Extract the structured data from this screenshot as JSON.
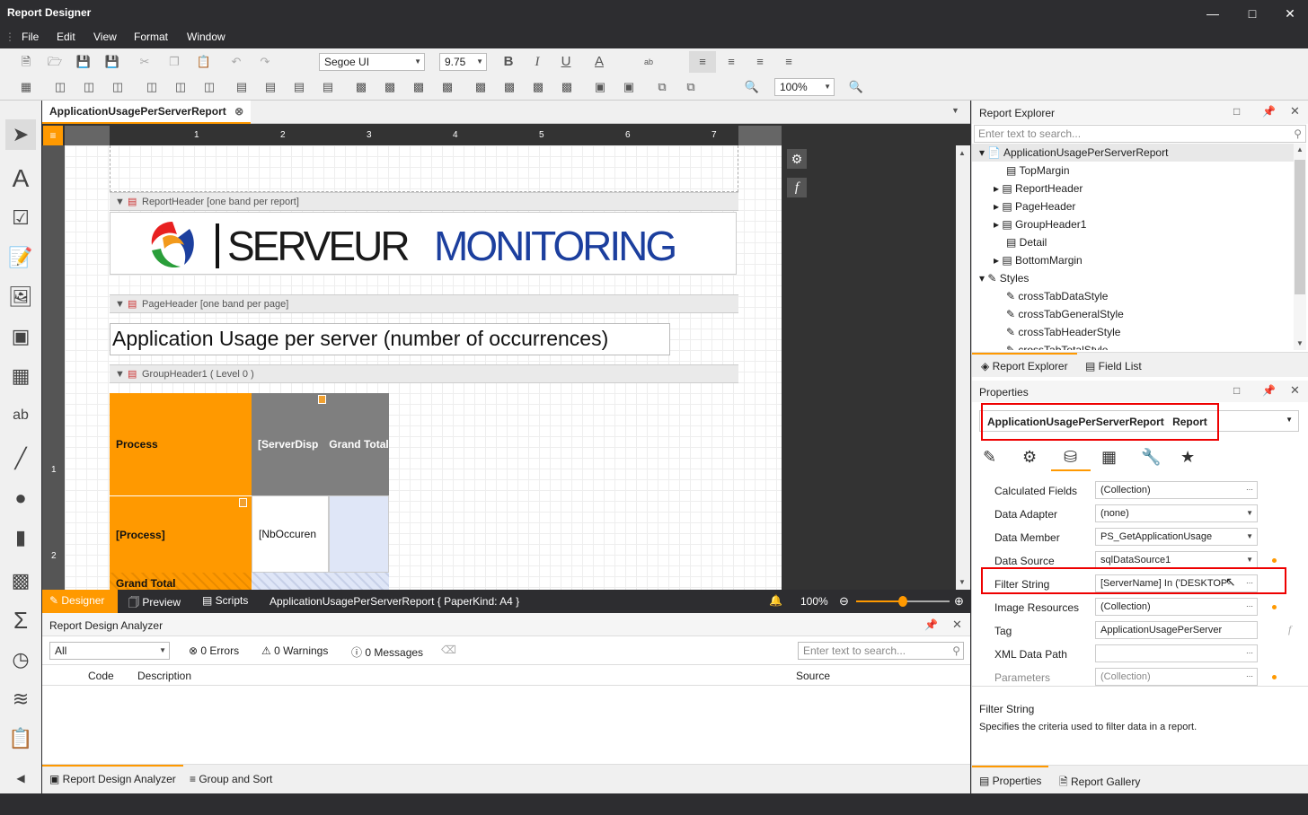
{
  "window": {
    "title": "Report Designer"
  },
  "menu": [
    "File",
    "Edit",
    "View",
    "Format",
    "Window"
  ],
  "toolbar": {
    "font_name": "Segoe UI",
    "font_size": "9.75",
    "zoom": "100%"
  },
  "document_tab": {
    "label": "ApplicationUsagePerServerReport"
  },
  "ruler": {
    "ticks": [
      "1",
      "2",
      "3",
      "4",
      "5",
      "6",
      "7"
    ],
    "vticks": [
      "1",
      "2"
    ]
  },
  "report": {
    "report_header_band": "ReportHeader [one band per report]",
    "logo_text_a": "SERVEUR",
    "logo_text_b": "MONITORING",
    "page_header_band": "PageHeader [one band per page]",
    "page_title": "Application Usage per server (number of occurrences)",
    "group_header_band": "GroupHeader1 ( Level 0 )",
    "crosstab": {
      "process_header": "Process",
      "server_header": "[ServerDisp",
      "grand_total_header": "Grand Total",
      "process_field": "[Process]",
      "occurrences_field": "[NbOccuren",
      "grand_total_row": "Grand Total"
    }
  },
  "status": {
    "designer": "Designer",
    "preview": "Preview",
    "scripts": "Scripts",
    "info": "ApplicationUsagePerServerReport { PaperKind: A4 }",
    "zoom": "100%",
    "zoom_level": 0.5
  },
  "analyzer": {
    "title": "Report Design Analyzer",
    "filter": "All",
    "errors": "0 Errors",
    "warnings": "0 Warnings",
    "messages": "0 Messages",
    "search_placeholder": "Enter text to search...",
    "columns": [
      "Code",
      "Description",
      "Source"
    ],
    "tabs": [
      "Report Design Analyzer",
      "Group and Sort"
    ]
  },
  "explorer": {
    "title": "Report Explorer",
    "search_placeholder": "Enter text to search...",
    "root": "ApplicationUsagePerServerReport",
    "items": [
      "TopMargin",
      "ReportHeader",
      "PageHeader",
      "GroupHeader1",
      "Detail",
      "BottomMargin"
    ],
    "styles_label": "Styles",
    "styles": [
      "crossTabDataStyle",
      "crossTabGeneralStyle",
      "crossTabHeaderStyle",
      "crossTabTotalStyle"
    ],
    "tabs": [
      "Report Explorer",
      "Field List"
    ]
  },
  "properties": {
    "title": "Properties",
    "selected_object": "ApplicationUsagePerServerReport",
    "selected_type": "Report",
    "rows": [
      {
        "name": "Calculated Fields",
        "value": "(Collection)"
      },
      {
        "name": "Data Adapter",
        "value": "(none)"
      },
      {
        "name": "Data Member",
        "value": "PS_GetApplicationUsage"
      },
      {
        "name": "Data Source",
        "value": "sqlDataSource1"
      },
      {
        "name": "Filter String",
        "value": "[ServerName] In ('DESKTOP-"
      },
      {
        "name": "Image Resources",
        "value": "(Collection)"
      },
      {
        "name": "Tag",
        "value": "ApplicationUsagePerServer"
      },
      {
        "name": "XML Data Path",
        "value": ""
      },
      {
        "name": "Parameters",
        "value": "(Collection)"
      }
    ],
    "description_title": "Filter String",
    "description_text": "Specifies the criteria used to filter data in a report.",
    "tabs": [
      "Properties",
      "Report Gallery"
    ]
  },
  "colors": {
    "orange": "#ff9900",
    "gray_header": "#7f7f7f",
    "logo_dark": "#1a1a1a",
    "logo_blue": "#1c3f9e",
    "highlight": "#e00000"
  }
}
